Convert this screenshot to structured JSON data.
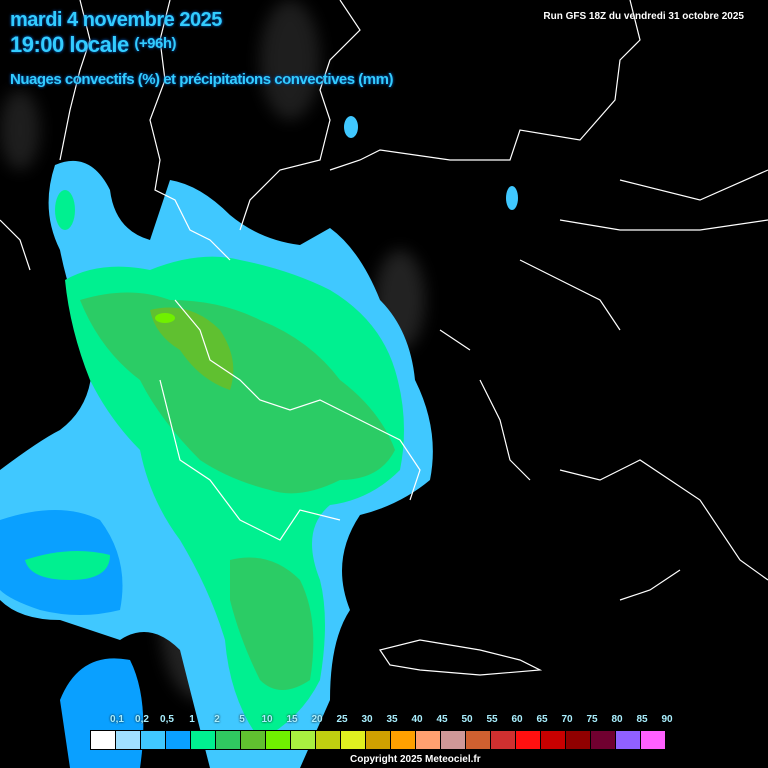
{
  "header": {
    "date": "mardi 4 novembre 2025",
    "time": "19:00 locale",
    "offset": "(+96h)",
    "subtitle": "Nuages convectifs (%) et précipitations convectives (mm)",
    "run": "Run GFS 18Z du vendredi 31 octobre 2025"
  },
  "legend": {
    "labels": [
      "0,1",
      "0,2",
      "0,5",
      "1",
      "2",
      "5",
      "10",
      "15",
      "20",
      "25",
      "30",
      "35",
      "40",
      "45",
      "50",
      "55",
      "60",
      "65",
      "70",
      "75",
      "80",
      "85",
      "90"
    ],
    "colors": [
      "#ffffff",
      "#a0e0ff",
      "#40c8ff",
      "#0aa0ff",
      "#00f090",
      "#30c860",
      "#60c030",
      "#70f000",
      "#a8f040",
      "#c0d010",
      "#e0f020",
      "#d0a000",
      "#ffa000",
      "#ffa070",
      "#d09898",
      "#d06030",
      "#d03030",
      "#ff1010",
      "#c80000",
      "#900000",
      "#700030",
      "#9060ff",
      "#ff60ff"
    ]
  },
  "footer": {
    "copyright": "Copyright 2025 Meteociel.fr"
  }
}
